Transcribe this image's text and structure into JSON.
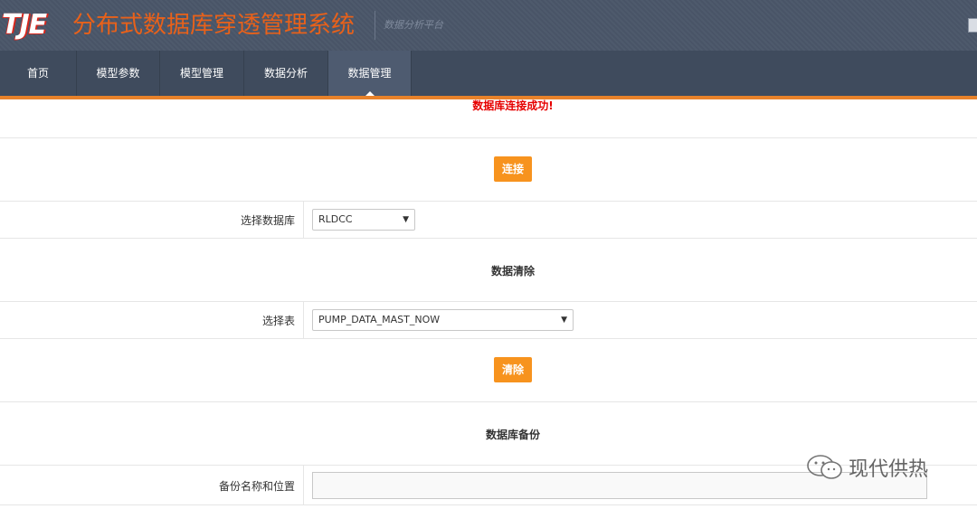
{
  "header": {
    "logo_text": "TJE",
    "app_title": "分布式数据库穿透管理系统",
    "subtitle": "数据分析平台"
  },
  "nav": {
    "items": [
      {
        "label": "首页"
      },
      {
        "label": "模型参数"
      },
      {
        "label": "模型管理"
      },
      {
        "label": "数据分析"
      },
      {
        "label": "数据管理"
      }
    ],
    "active": "数据管理"
  },
  "status": {
    "message": "数据库连接成功!"
  },
  "connect": {
    "button_label": "连接"
  },
  "database_select": {
    "label": "选择数据库",
    "value": "RLDCC"
  },
  "cleanup": {
    "title": "数据清除",
    "table_label": "选择表",
    "table_value": "PUMP_DATA_MAST_NOW",
    "button_label": "清除"
  },
  "backup": {
    "title": "数据库备份",
    "name_label": "备份名称和位置",
    "name_value": ""
  },
  "watermark": {
    "text": "现代供热"
  },
  "colors": {
    "header_bg": "#4a5669",
    "nav_bg": "#3f4b5d",
    "accent_orange": "#f7931e",
    "title_orange": "#e8611a",
    "status_red": "#e60000"
  }
}
